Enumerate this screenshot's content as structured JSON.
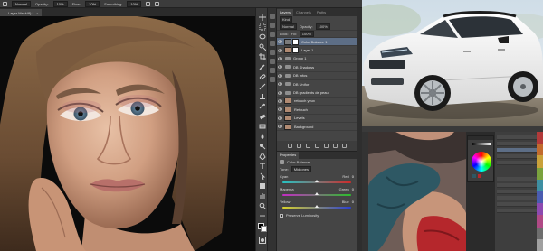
{
  "options_bar": {
    "mode_label": "Normal",
    "opacity_label": "Opacity:",
    "opacity_value": "10%",
    "flow_label": "Flow:",
    "flow_value": "10%",
    "smoothing_label": "Smoothing:",
    "smoothing_value": "10%"
  },
  "document_tab": {
    "title": "… Layer Mask/8) *",
    "close": "×"
  },
  "layers_panel": {
    "tabs": [
      "Layers",
      "Channels",
      "Paths"
    ],
    "kind_label": "Kind",
    "blend_mode": "Normal",
    "opacity_label": "Opacity:",
    "opacity_value": "100%",
    "lock_label": "Lock:",
    "fill_label": "Fill:",
    "fill_value": "100%",
    "layers": [
      {
        "name": "Color Balance 1",
        "kind": "adjustment",
        "selected": true
      },
      {
        "name": "Layer 1",
        "kind": "pixel",
        "selected": false
      },
      {
        "name": "Group 1",
        "kind": "group",
        "selected": false
      },
      {
        "name": "DB Shadows",
        "kind": "group",
        "selected": false
      },
      {
        "name": "DB Infos",
        "kind": "group",
        "selected": false
      },
      {
        "name": "DB Unifor",
        "kind": "group",
        "selected": false
      },
      {
        "name": "DB gradients de peau",
        "kind": "group",
        "selected": false
      },
      {
        "name": "retouch yeux",
        "kind": "pixel",
        "selected": false
      },
      {
        "name": "Retouch",
        "kind": "pixel",
        "selected": false
      },
      {
        "name": "Levels",
        "kind": "pixel",
        "selected": false
      },
      {
        "name": "Background",
        "kind": "pixel",
        "selected": false
      }
    ]
  },
  "properties_panel": {
    "tab": "Properties",
    "adjustment_name": "Color Balance",
    "tone_label": "Tone:",
    "tone_value": "Midtones",
    "sliders": [
      {
        "left": "Cyan",
        "right": "Red",
        "value": "0",
        "fraction": 0.5,
        "gradient": [
          "#27c3c3",
          "#d12a2a"
        ]
      },
      {
        "left": "Magenta",
        "right": "Green",
        "value": "0",
        "fraction": 0.5,
        "gradient": [
          "#c42bc4",
          "#2bbf2b"
        ]
      },
      {
        "left": "Yellow",
        "right": "Blue",
        "value": "0",
        "fraction": 0.5,
        "gradient": [
          "#d8d22a",
          "#2b3fd1"
        ]
      }
    ],
    "preserve_label": "Preserve Luminosity"
  },
  "colors": {
    "accent_selected": "#5d6e86",
    "panel_bg": "#454545",
    "car_body": "#f2f2f2"
  },
  "right_panel_swatches": [
    "#b23a3a",
    "#c26b2e",
    "#c9a13a",
    "#7aa23e",
    "#3e8fa2",
    "#4a5cb0",
    "#8d4ab0",
    "#b04a86",
    "#6e6e6e",
    "#a0a0a0"
  ]
}
